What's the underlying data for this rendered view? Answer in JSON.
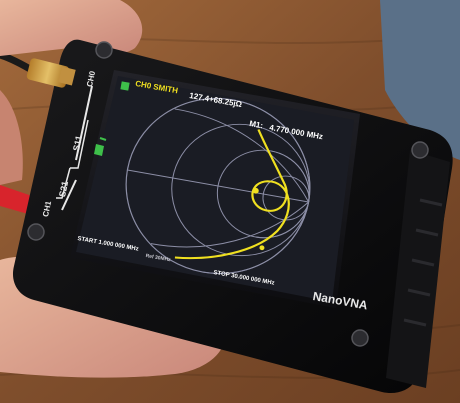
{
  "device": {
    "brand": "NanoVNA",
    "ports": {
      "ch0": "CH0",
      "ch1": "CH1",
      "s11": "S11",
      "s21": "S21"
    }
  },
  "screen": {
    "trace_label": "CH0 SMITH",
    "marker_impedance": "127.4+68.25jΩ",
    "marker_freq_label": "M1:",
    "marker_freq": "4.770 000 MHz",
    "start": "START 1.000 000 MHz",
    "stop": "STOP 30.000 000 MHz",
    "bottom_mid": "Ref 30MHz",
    "left_icon": "paw-icon",
    "colors": {
      "trace": "#f0e020",
      "grid": "#8c8ea6",
      "background": "#1a1c24",
      "text": "#ffffff",
      "marker_trace_label": "#f0e020",
      "green_icon": "#3ec04a"
    }
  }
}
